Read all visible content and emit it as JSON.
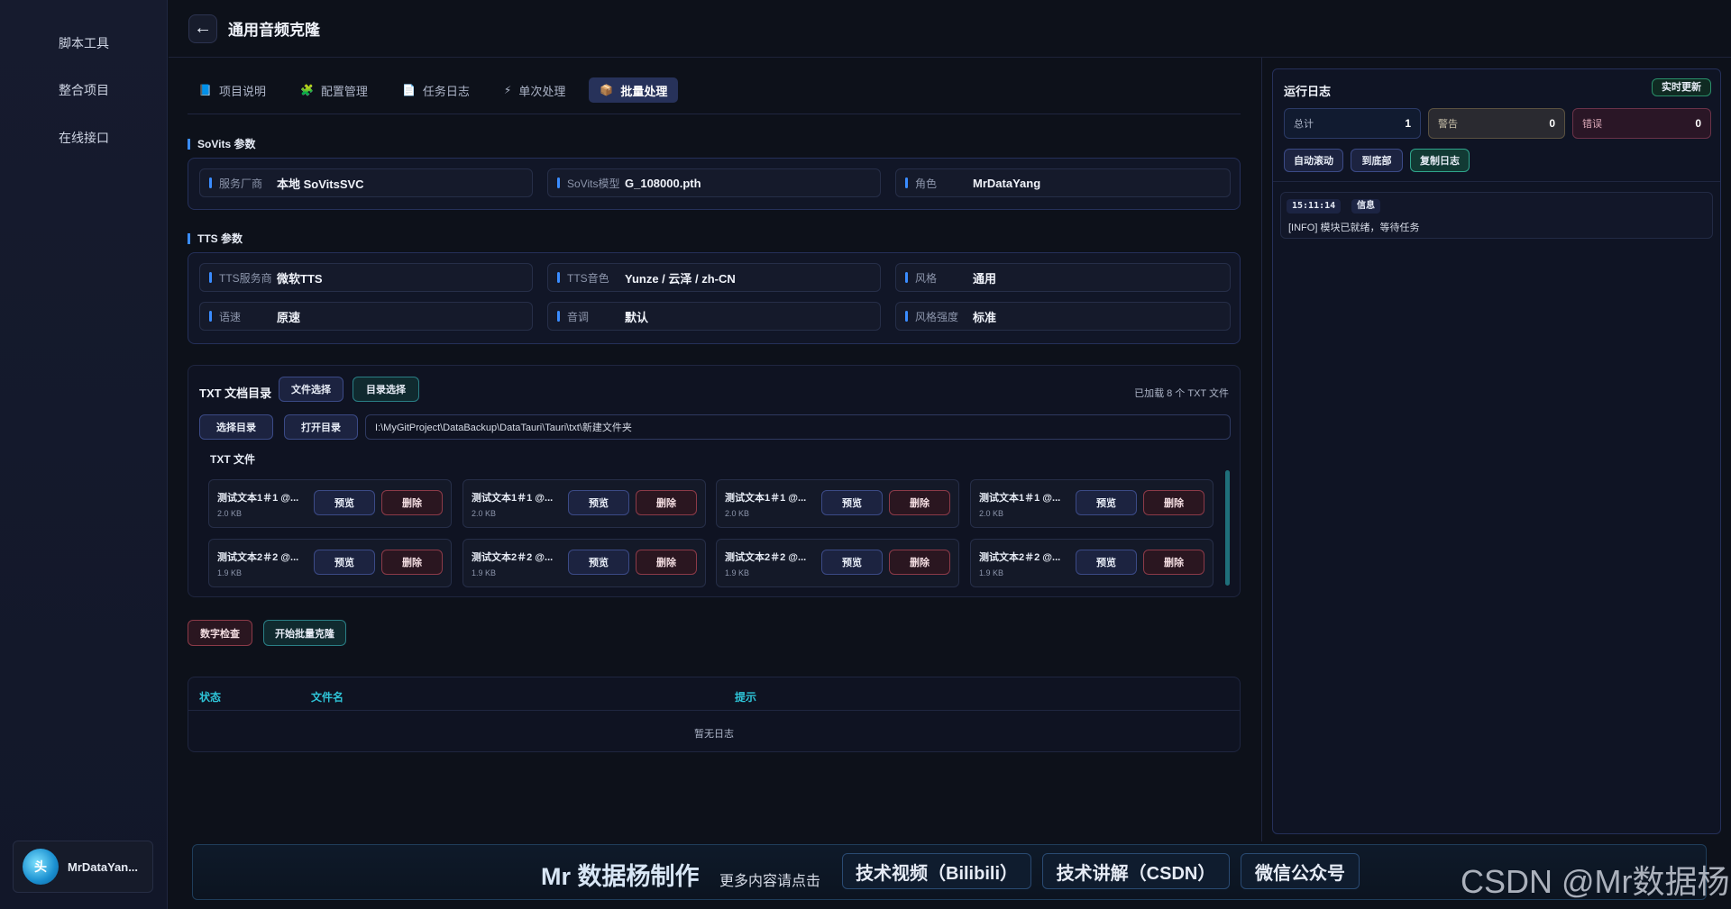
{
  "sidebar": {
    "items": [
      {
        "label": "脚本工具"
      },
      {
        "label": "整合项目"
      },
      {
        "label": "在线接口"
      }
    ],
    "user": {
      "avatar_text": "头",
      "name": "MrDataYan..."
    }
  },
  "header": {
    "back_icon": "←",
    "title": "通用音频克隆"
  },
  "tabs": [
    {
      "icon": "📘",
      "label": "项目说明"
    },
    {
      "icon": "🧩",
      "label": "配置管理"
    },
    {
      "icon": "📄",
      "label": "任务日志"
    },
    {
      "icon": "⚡",
      "label": "单次处理"
    },
    {
      "icon": "📦",
      "label": "批量处理",
      "active": true
    }
  ],
  "sovits": {
    "title": "SoVits 参数",
    "fields": [
      {
        "label": "服务厂商",
        "value": "本地 SoVitsSVC"
      },
      {
        "label": "SoVits模型",
        "value": "G_108000.pth"
      },
      {
        "label": "角色",
        "value": "MrDataYang"
      }
    ]
  },
  "tts": {
    "title": "TTS 参数",
    "fields": [
      {
        "label": "TTS服务商",
        "value": "微软TTS"
      },
      {
        "label": "TTS音色",
        "value": "Yunze / 云泽 / zh-CN"
      },
      {
        "label": "风格",
        "value": "通用"
      },
      {
        "label": "语速",
        "value": "原速"
      },
      {
        "label": "音调",
        "value": "默认"
      },
      {
        "label": "风格强度",
        "value": "标准"
      }
    ]
  },
  "txt": {
    "title": "TXT 文档目录",
    "file_select": "文件选择",
    "dir_select": "目录选择",
    "loaded": "已加载 8 个 TXT 文件",
    "choose_dir": "选择目录",
    "open_dir": "打开目录",
    "path": "I:\\MyGitProject\\DataBackup\\DataTauri\\Tauri\\txt\\新建文件夹",
    "files_title": "TXT 文件",
    "preview": "预览",
    "delete": "删除",
    "files": [
      {
        "name": "测试文本1＃1 @...",
        "size": "2.0 KB"
      },
      {
        "name": "测试文本1＃1 @...",
        "size": "2.0 KB"
      },
      {
        "name": "测试文本1＃1 @...",
        "size": "2.0 KB"
      },
      {
        "name": "测试文本1＃1 @...",
        "size": "2.0 KB"
      },
      {
        "name": "测试文本2＃2 @...",
        "size": "1.9 KB"
      },
      {
        "name": "测试文本2＃2 @...",
        "size": "1.9 KB"
      },
      {
        "name": "测试文本2＃2 @...",
        "size": "1.9 KB"
      },
      {
        "name": "测试文本2＃2 @...",
        "size": "1.9 KB"
      }
    ]
  },
  "actions": {
    "check": "数字检查",
    "start": "开始批量克隆"
  },
  "result_table": {
    "headers": [
      "状态",
      "文件名",
      "提示"
    ],
    "empty": "暂无日志"
  },
  "log": {
    "title": "运行日志",
    "badge": "实时更新",
    "stats": [
      {
        "label": "总计",
        "value": "1"
      },
      {
        "label": "警告",
        "value": "0"
      },
      {
        "label": "错误",
        "value": "0"
      }
    ],
    "buttons": [
      "自动滚动",
      "到底部",
      "复制日志"
    ],
    "entries": [
      {
        "time": "15:11:14",
        "level": "信息",
        "message": "[INFO] 模块已就绪，等待任务"
      }
    ]
  },
  "footer": {
    "brand": "Mr 数据杨制作",
    "sub": "更多内容请点击",
    "links": [
      "技术视频（Bilibili）",
      "技术讲解（CSDN）",
      "微信公众号"
    ]
  },
  "watermark": "CSDN @Mr数据杨",
  "colors": {
    "accent": "#3a8cff",
    "teal": "#2ec4d8",
    "danger": "#8c3a48"
  }
}
